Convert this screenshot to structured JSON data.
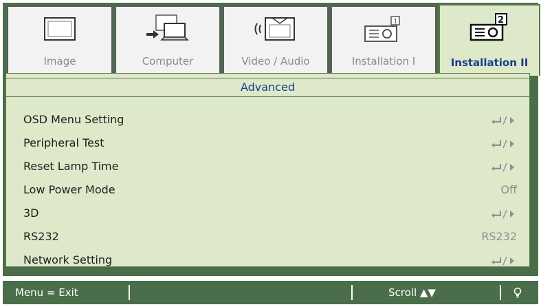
{
  "tabs": [
    {
      "label": "Image",
      "icon": "monitor-icon",
      "active": false
    },
    {
      "label": "Computer",
      "icon": "computer-icon",
      "active": false
    },
    {
      "label": "Video / Audio",
      "icon": "video-audio-icon",
      "active": false
    },
    {
      "label": "Installation I",
      "icon": "projector-icon",
      "active": false
    },
    {
      "label": "Installation II",
      "icon": "projector-2-icon",
      "active": true
    }
  ],
  "panel": {
    "section_title": "Advanced",
    "rows": [
      {
        "label": "OSD Menu Setting",
        "value": ""
      },
      {
        "label": "Peripheral Test",
        "value": ""
      },
      {
        "label": "Reset Lamp Time",
        "value": ""
      },
      {
        "label": "Low Power Mode",
        "value": "Off"
      },
      {
        "label": "3D",
        "value": ""
      },
      {
        "label": "RS232",
        "value": "RS232"
      },
      {
        "label": "Network Setting",
        "value": ""
      }
    ]
  },
  "footer": {
    "menu_hint": "Menu = Exit",
    "scroll_hint": "Scroll ▲▼",
    "bulb_icon": "bulb-icon"
  },
  "colors": {
    "frame": "#4a6e4a",
    "panel": "#dde9c9",
    "accent_text": "#1a3c8a"
  }
}
